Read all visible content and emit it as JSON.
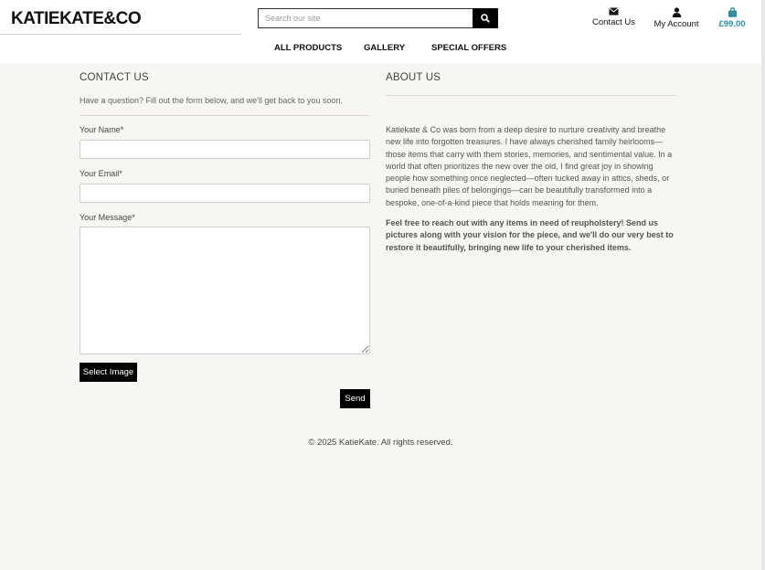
{
  "header": {
    "logo": "KATIEKATE&CO",
    "search_placeholder": "Search our site",
    "contact_label": "Contact Us",
    "account_label": "My Account",
    "bag_total": "£99.00",
    "accent_color": "#2a8fa8"
  },
  "nav": {
    "items": [
      "ALL PRODUCTS",
      "GALLERY",
      "SPECIAL OFFERS"
    ]
  },
  "contact": {
    "title": "CONTACT US",
    "intro": "Have a question? Fill out the form below, and we'll get back to you soon.",
    "name_label": "Your Name*",
    "email_label": "Your Email*",
    "message_label": "Your Message*",
    "select_image_label": "Select Image",
    "send_label": "Send"
  },
  "about": {
    "title": "ABOUT US",
    "paragraph1": "Katiekate & Co was born from a deep desire to nurture creativity and breathe new life into forgotten treasures. I have always cherished family heirlooms—those items that carry with them stories, memories, and sentimental value. In a world that often prioritizes the new over the old, I find great joy in showing people how something once neglected—often tucked away in attics, sheds, or buried beneath piles of belongings—can be beautifully transformed into a bespoke, one-of-a-kind piece that holds meaning for them.",
    "paragraph2": "Feel free to reach out with any items in need of reupholstery! Send us pictures along with your vision for the piece, and we'll do our very best to restore it beautifully, bringing new life to your cherished items."
  },
  "footer": {
    "copyright": "© 2025 KatieKate. All rights reserved."
  }
}
